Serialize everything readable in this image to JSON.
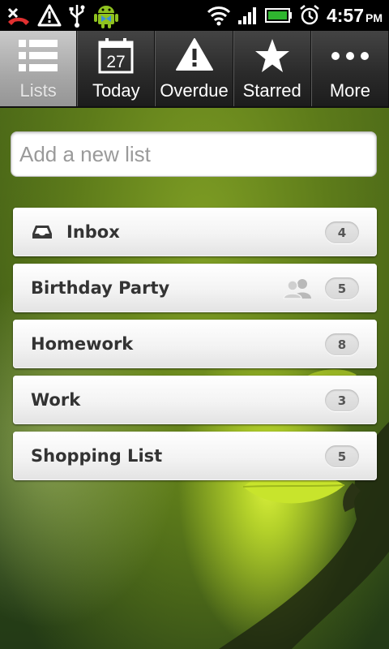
{
  "status_bar": {
    "time": "4:57",
    "ampm": "PM",
    "icons_left": [
      "missed-call-icon",
      "warning-icon",
      "usb-icon",
      "android-icon"
    ],
    "icons_right": [
      "wifi-icon",
      "signal-icon",
      "battery-icon",
      "alarm-icon"
    ]
  },
  "tabs": [
    {
      "label": "Lists",
      "icon": "list-icon",
      "active": true
    },
    {
      "label": "Today",
      "icon": "calendar-icon",
      "day": "27",
      "active": false
    },
    {
      "label": "Overdue",
      "icon": "warning-icon",
      "active": false
    },
    {
      "label": "Starred",
      "icon": "star-icon",
      "active": false
    },
    {
      "label": "More",
      "icon": "more-icon",
      "active": false
    }
  ],
  "new_list": {
    "placeholder": "Add a new list",
    "value": ""
  },
  "lists": [
    {
      "name": "Inbox",
      "count": "4",
      "icon": "inbox-icon"
    },
    {
      "name": "Birthday Party",
      "count": "5",
      "icon": "shared-users-icon"
    },
    {
      "name": "Homework",
      "count": "8"
    },
    {
      "name": "Work",
      "count": "3"
    },
    {
      "name": "Shopping List",
      "count": "5"
    }
  ],
  "colors": {
    "tab_active": "#a7a7a7",
    "tab_bar": "#2b2b2b",
    "card_text": "#333333"
  }
}
